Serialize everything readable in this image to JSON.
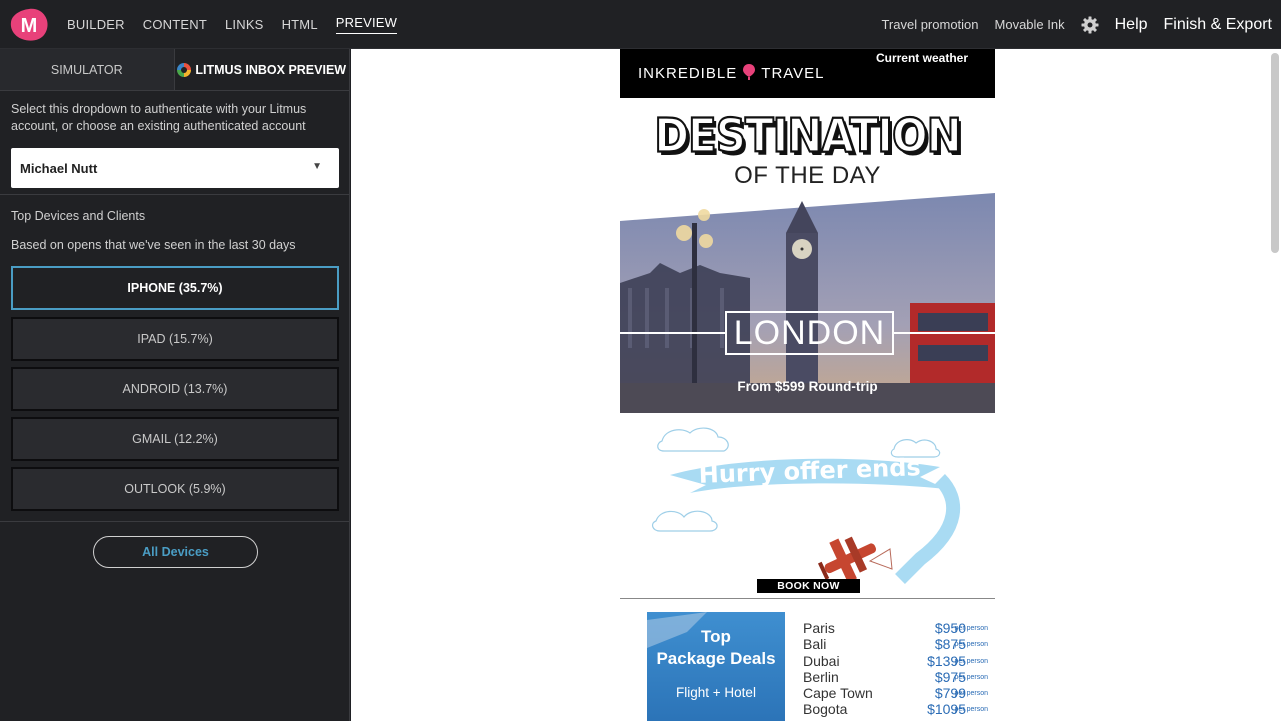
{
  "topbar": {
    "logo_letter": "M",
    "nav": [
      "BUILDER",
      "CONTENT",
      "LINKS",
      "HTML",
      "PREVIEW"
    ],
    "active_nav": "PREVIEW",
    "campaign": "Travel promotion",
    "company": "Movable Ink",
    "help": "Help",
    "finish": "Finish & Export"
  },
  "sidebar": {
    "tabs": [
      "SIMULATOR",
      "LITMUS INBOX PREVIEW"
    ],
    "help_text": "Select this dropdown to authenticate with your Litmus account, or choose an existing authenticated account",
    "account": "Michael Nutt",
    "top_devices_label": "Top Devices and Clients",
    "based_on_label": "Based on opens that we've seen in the last 30 days",
    "devices": [
      "IPHONE (35.7%)",
      "IPAD (15.7%)",
      "ANDROID (13.7%)",
      "GMAIL (12.2%)",
      "OUTLOOK (5.9%)"
    ],
    "all_devices": "All Devices"
  },
  "email": {
    "brand": "INKREDIBLE",
    "brand2": "TRAVEL",
    "weather": "Current weather",
    "title": "DESTINATION",
    "subtitle": "OF THE DAY",
    "city": "LONDON",
    "price": "From $599 Round-trip",
    "banner": "Hurry offer ends",
    "book_now": "BOOK NOW",
    "deal_title_1": "Top",
    "deal_title_2": "Package Deals",
    "deal_sub": "Flight + Hotel",
    "per_person": "per person",
    "deals": [
      {
        "city": "Paris",
        "price": "$950"
      },
      {
        "city": "Bali",
        "price": "$875"
      },
      {
        "city": "Dubai",
        "price": "$1395"
      },
      {
        "city": "Berlin",
        "price": "$975"
      },
      {
        "city": "Cape Town",
        "price": "$799"
      },
      {
        "city": "Bogota",
        "price": "$1095"
      }
    ]
  },
  "colors": {
    "accent": "#4a9dc4",
    "logo": "#e8417a",
    "topbar": "#202124"
  }
}
